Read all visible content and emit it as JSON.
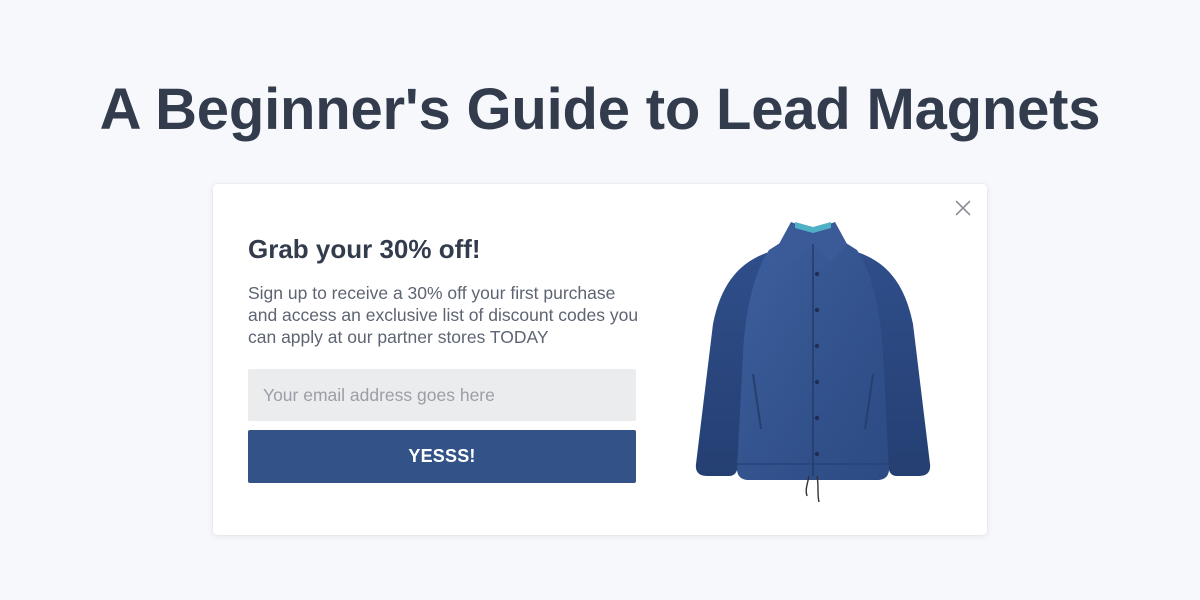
{
  "page": {
    "title": "A Beginner's Guide to Lead Magnets",
    "background_color": "#f7f8fc"
  },
  "popup": {
    "headline": "Grab your 30% off!",
    "description": "Sign up to receive a 30% off your first purchase and access an exclusive list of discount codes you can apply at our partner stores TODAY",
    "email_input": {
      "value": "",
      "placeholder": "Your email address goes here"
    },
    "submit_label": "YESSS!",
    "close_icon": "close-icon",
    "product_image": "denim-jacket",
    "colors": {
      "button": "#335287",
      "heading": "#333c4d",
      "input_bg": "#ebecee"
    }
  }
}
